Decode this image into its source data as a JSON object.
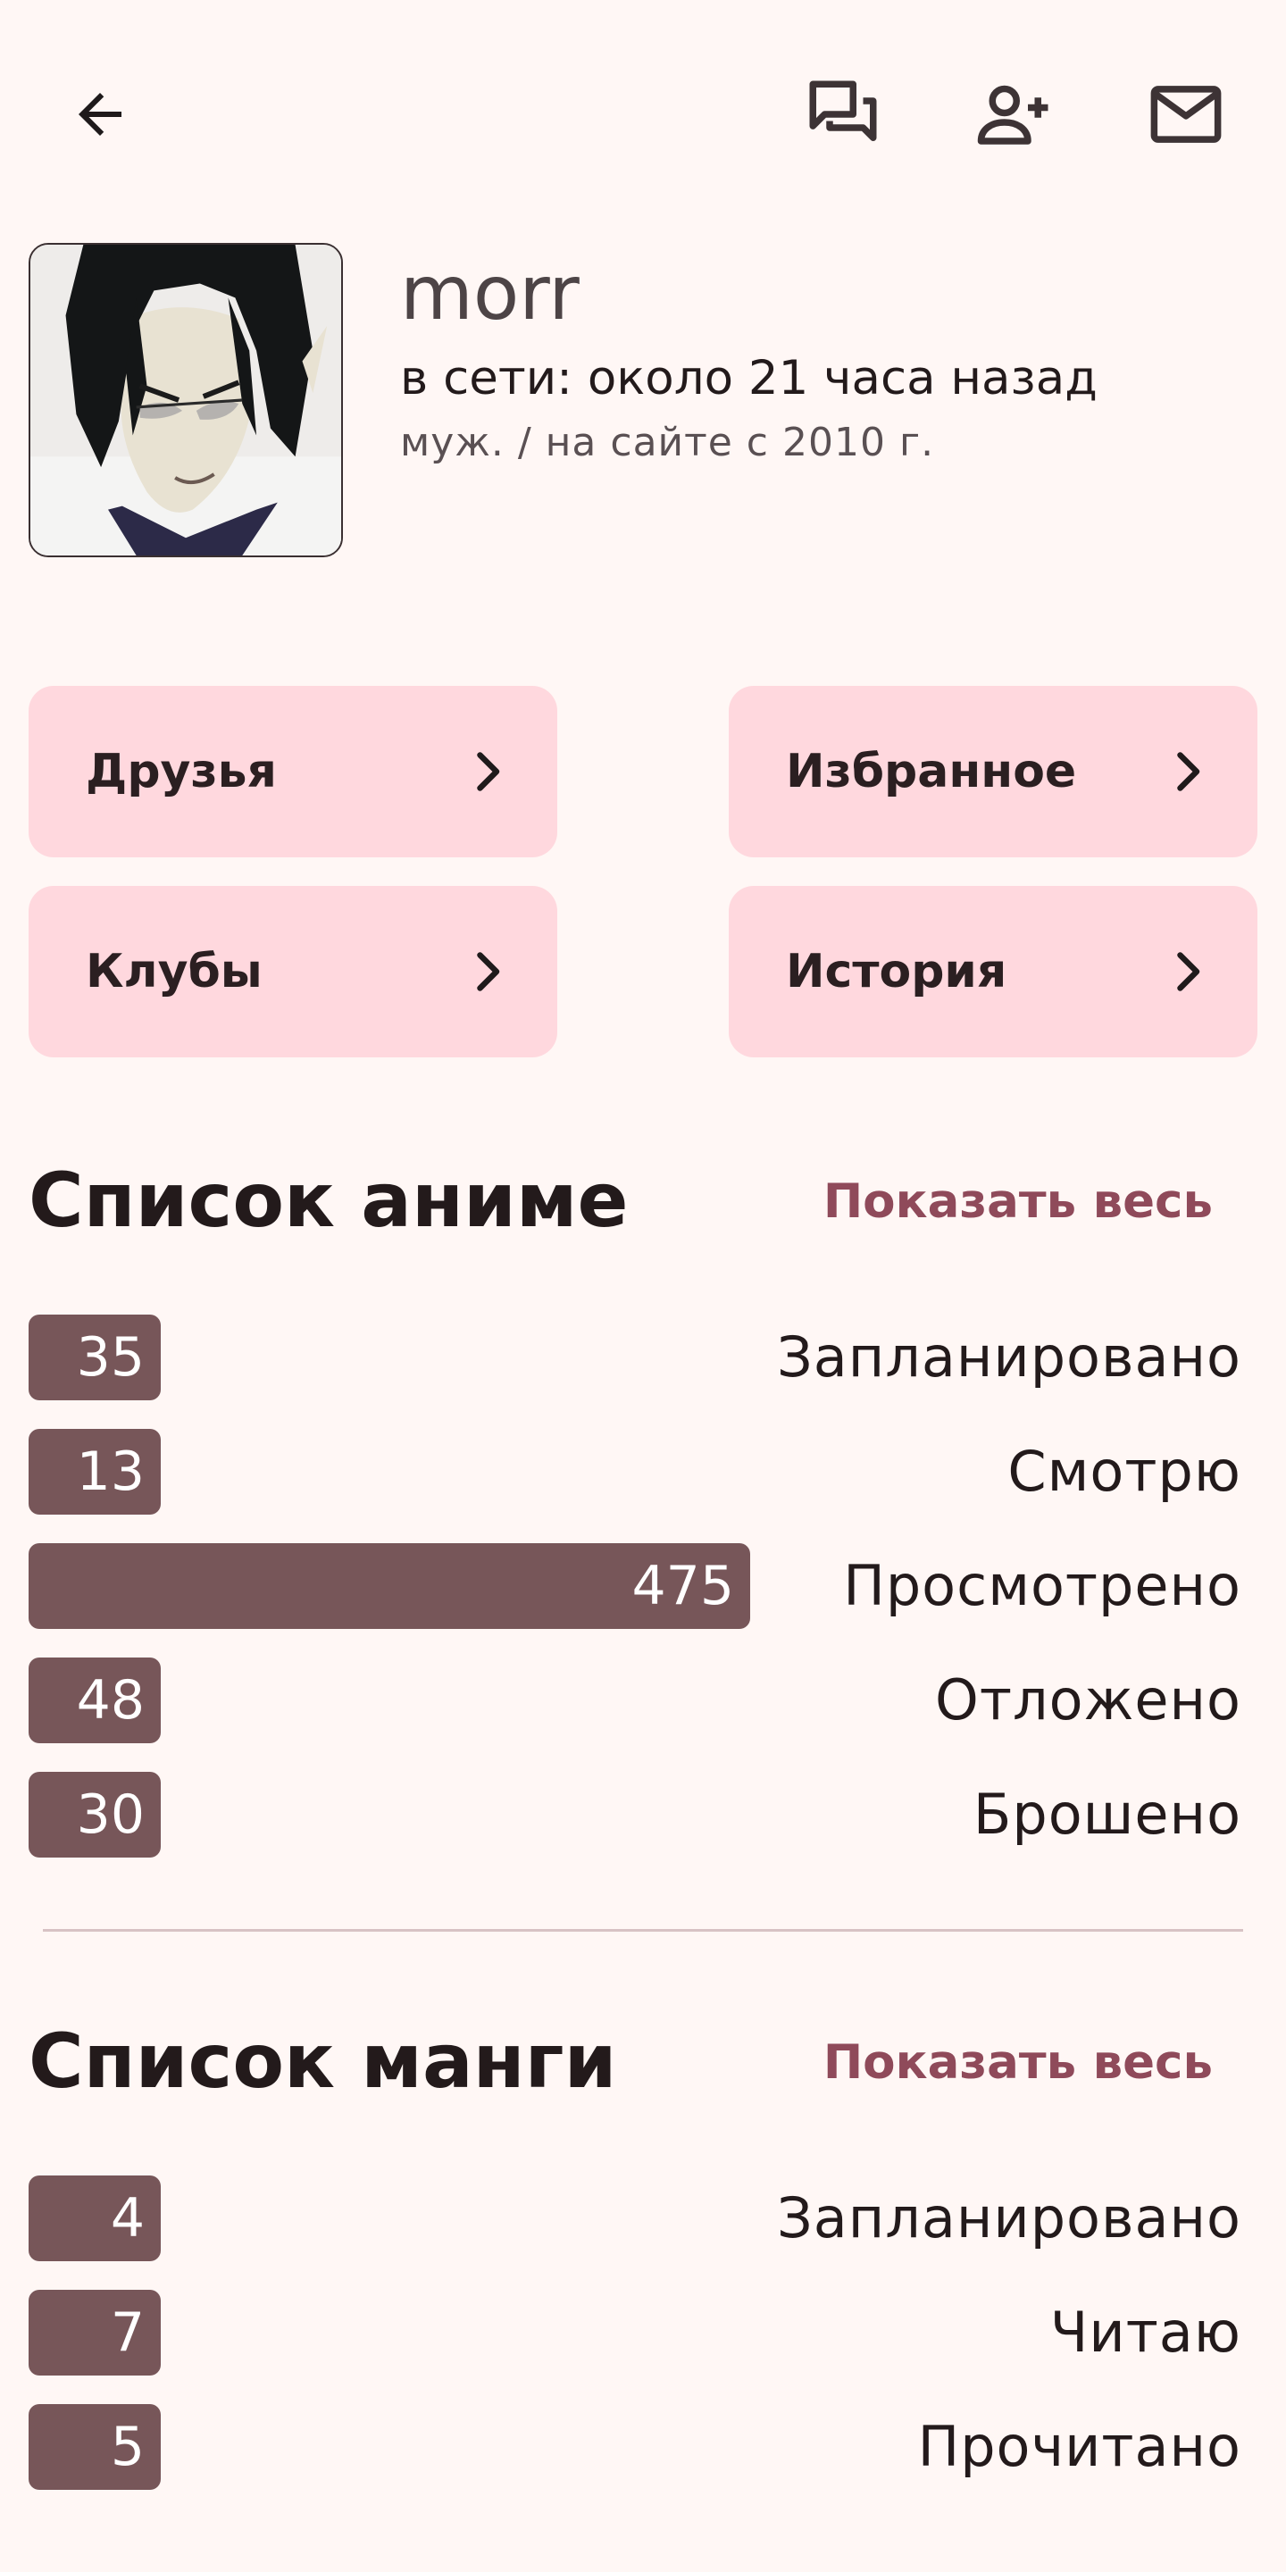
{
  "topbar": {
    "back_icon": "arrow-back-icon",
    "chat_icon": "forum-icon",
    "add_friend_icon": "person-add-icon",
    "mail_icon": "mail-icon"
  },
  "profile": {
    "username": "morr",
    "online_status": "в сети: около 21 часа назад",
    "meta": "муж. / на сайте с 2010 г."
  },
  "nav_cards": {
    "friends": "Друзья",
    "favorites": "Избранное",
    "clubs": "Клубы",
    "history": "История"
  },
  "anime": {
    "title": "Список аниме",
    "show_all": "Показать весь",
    "max_value": 475,
    "stats": [
      {
        "label": "Запланировано",
        "value": 35
      },
      {
        "label": "Смотрю",
        "value": 13
      },
      {
        "label": "Просмотрено",
        "value": 475
      },
      {
        "label": "Отложено",
        "value": 48
      },
      {
        "label": "Брошено",
        "value": 30
      }
    ]
  },
  "manga": {
    "title": "Список манги",
    "show_all": "Показать весь",
    "max_value": 475,
    "stats": [
      {
        "label": "Запланировано",
        "value": 4
      },
      {
        "label": "Читаю",
        "value": 7
      },
      {
        "label": "Прочитано",
        "value": 5
      }
    ]
  },
  "colors": {
    "background": "#fff7f5",
    "card": "#ffd8de",
    "bar": "#775659",
    "accent": "#8f4a5a"
  }
}
